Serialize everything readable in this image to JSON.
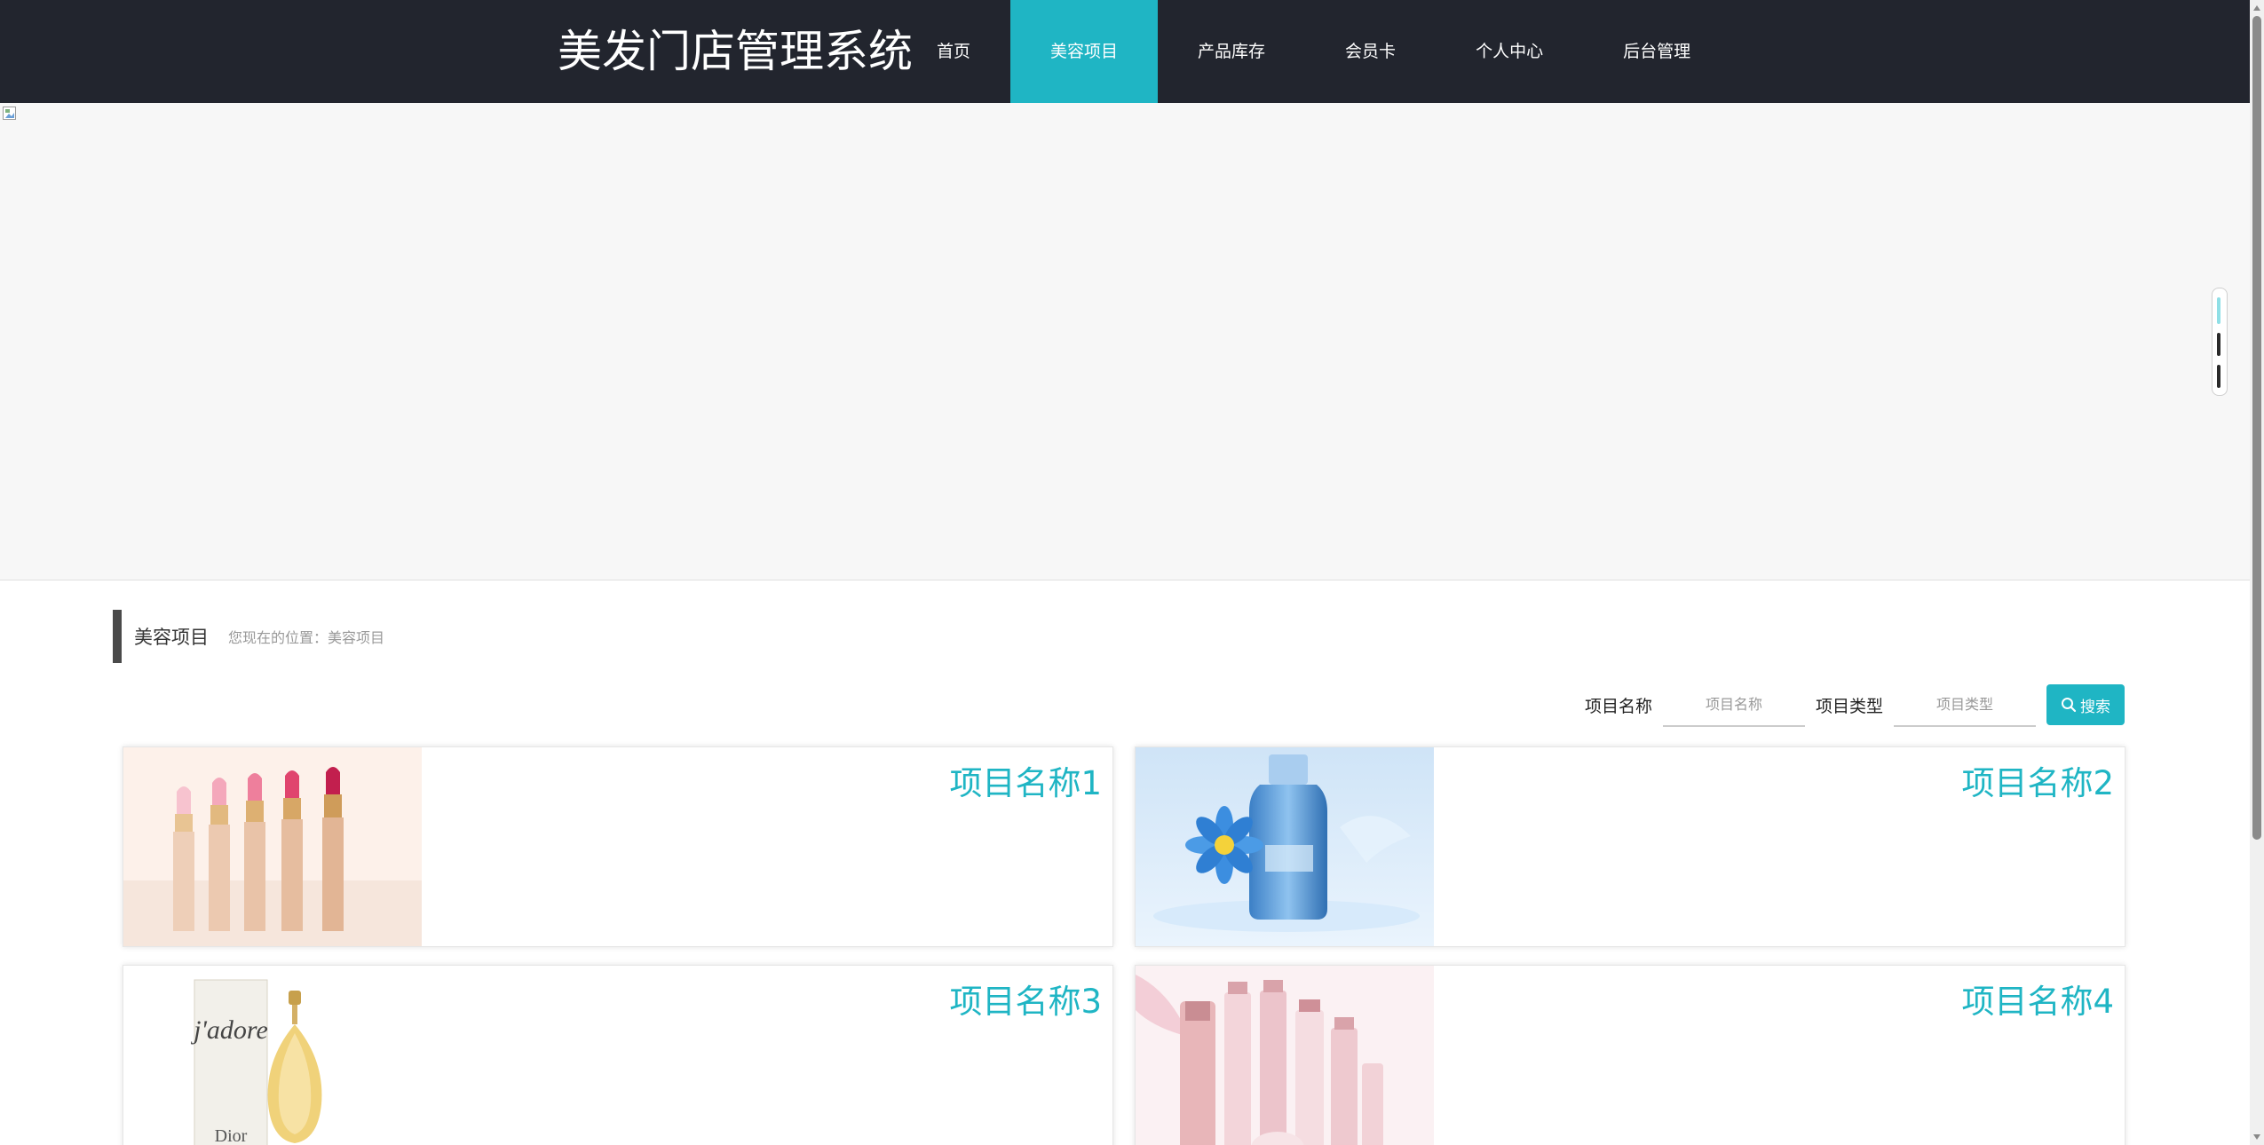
{
  "header": {
    "logo": "美发门店管理系统",
    "nav": [
      {
        "label": "首页",
        "active": false
      },
      {
        "label": "美容项目",
        "active": true
      },
      {
        "label": "产品库存",
        "active": false
      },
      {
        "label": "会员卡",
        "active": false
      },
      {
        "label": "个人中心",
        "active": false
      },
      {
        "label": "后台管理",
        "active": false
      }
    ]
  },
  "section": {
    "title": "美容项目",
    "breadcrumb": "您现在的位置：美容项目"
  },
  "search": {
    "name_label": "项目名称",
    "name_placeholder": "项目名称",
    "type_label": "项目类型",
    "type_placeholder": "项目类型",
    "button_label": "搜索"
  },
  "items": [
    {
      "title": "项目名称1",
      "image": "lipsticks"
    },
    {
      "title": "项目名称2",
      "image": "blue-bottle"
    },
    {
      "title": "项目名称3",
      "image": "perfume"
    },
    {
      "title": "项目名称4",
      "image": "pink-cosmetics"
    }
  ],
  "colors": {
    "header_bg": "#22252e",
    "accent": "#1fb5c4"
  }
}
